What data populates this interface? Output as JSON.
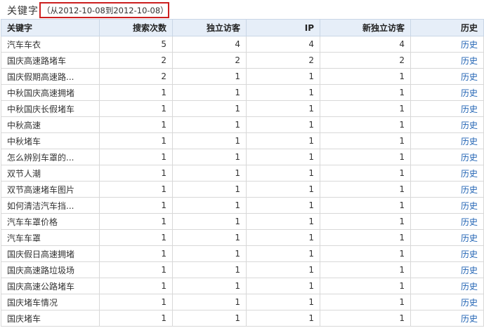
{
  "header": {
    "title": "关键字",
    "range": "（从2012-10-08到2012-10-08）"
  },
  "table": {
    "columns": [
      "关键字",
      "搜索次数",
      "独立访客",
      "IP",
      "新独立访客",
      "历史"
    ],
    "rows": [
      {
        "keyword": "汽车车衣",
        "searches": "5",
        "uv": "4",
        "ip": "4",
        "new_uv": "4",
        "history": "历史"
      },
      {
        "keyword": "国庆高速路堵车",
        "searches": "2",
        "uv": "2",
        "ip": "2",
        "new_uv": "2",
        "history": "历史"
      },
      {
        "keyword": "国庆假期高速路...",
        "searches": "2",
        "uv": "1",
        "ip": "1",
        "new_uv": "1",
        "history": "历史"
      },
      {
        "keyword": "中秋国庆高速拥堵",
        "searches": "1",
        "uv": "1",
        "ip": "1",
        "new_uv": "1",
        "history": "历史"
      },
      {
        "keyword": "中秋国庆长假堵车",
        "searches": "1",
        "uv": "1",
        "ip": "1",
        "new_uv": "1",
        "history": "历史"
      },
      {
        "keyword": "中秋高速",
        "searches": "1",
        "uv": "1",
        "ip": "1",
        "new_uv": "1",
        "history": "历史"
      },
      {
        "keyword": "中秋堵车",
        "searches": "1",
        "uv": "1",
        "ip": "1",
        "new_uv": "1",
        "history": "历史"
      },
      {
        "keyword": "怎么辨别车罩的...",
        "searches": "1",
        "uv": "1",
        "ip": "1",
        "new_uv": "1",
        "history": "历史"
      },
      {
        "keyword": "双节人潮",
        "searches": "1",
        "uv": "1",
        "ip": "1",
        "new_uv": "1",
        "history": "历史"
      },
      {
        "keyword": "双节高速堵车图片",
        "searches": "1",
        "uv": "1",
        "ip": "1",
        "new_uv": "1",
        "history": "历史"
      },
      {
        "keyword": "如何清洁汽车挡...",
        "searches": "1",
        "uv": "1",
        "ip": "1",
        "new_uv": "1",
        "history": "历史"
      },
      {
        "keyword": "汽车车罩价格",
        "searches": "1",
        "uv": "1",
        "ip": "1",
        "new_uv": "1",
        "history": "历史"
      },
      {
        "keyword": "汽车车罩",
        "searches": "1",
        "uv": "1",
        "ip": "1",
        "new_uv": "1",
        "history": "历史"
      },
      {
        "keyword": "国庆假日高速拥堵",
        "searches": "1",
        "uv": "1",
        "ip": "1",
        "new_uv": "1",
        "history": "历史"
      },
      {
        "keyword": "国庆高速路垃圾场",
        "searches": "1",
        "uv": "1",
        "ip": "1",
        "new_uv": "1",
        "history": "历史"
      },
      {
        "keyword": "国庆高速公路堵车",
        "searches": "1",
        "uv": "1",
        "ip": "1",
        "new_uv": "1",
        "history": "历史"
      },
      {
        "keyword": "国庆堵车情况",
        "searches": "1",
        "uv": "1",
        "ip": "1",
        "new_uv": "1",
        "history": "历史"
      },
      {
        "keyword": "国庆堵车",
        "searches": "1",
        "uv": "1",
        "ip": "1",
        "new_uv": "1",
        "history": "历史"
      }
    ]
  },
  "colors": {
    "range_border": "#cc1f1f",
    "header_bg": "#e6eef8",
    "link": "#1f62b3",
    "uv_highlight": "#5a8a1a"
  }
}
